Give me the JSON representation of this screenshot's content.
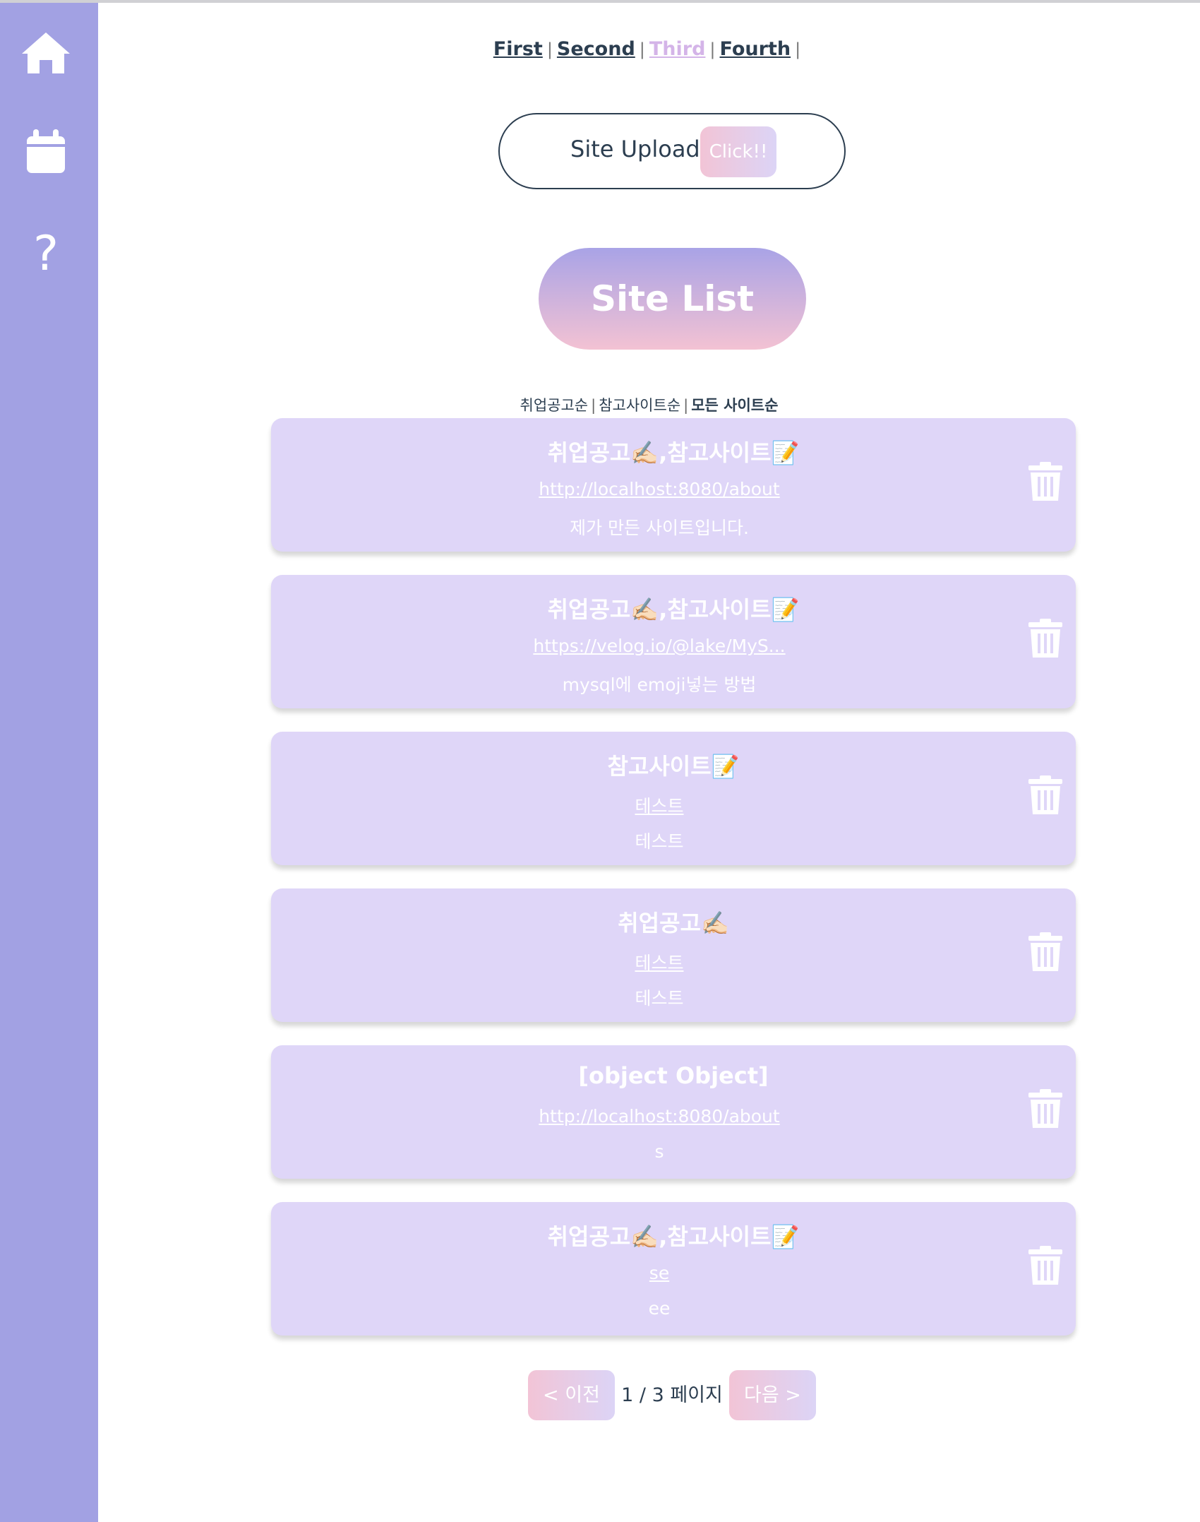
{
  "colors": {
    "sidebar": "#a2a1e3",
    "card": "#dfd6f8",
    "accent_gradient": [
      "#f2c4d6",
      "#dcd4f6"
    ],
    "text": "#2c3e50",
    "active_nav": "#d4b4e8"
  },
  "sidebar": {
    "items": [
      {
        "icon": "home-icon"
      },
      {
        "icon": "calendar-icon"
      },
      {
        "icon": "help-icon",
        "glyph": "?"
      }
    ]
  },
  "nav": {
    "links": [
      {
        "label": "First"
      },
      {
        "label": "Second"
      },
      {
        "label": "Third",
        "active": true
      },
      {
        "label": "Fourth"
      }
    ],
    "separator": "|"
  },
  "upload": {
    "label": "Site Upload",
    "button": "Click!!"
  },
  "site_list": {
    "title": "Site List",
    "sort_options": [
      "취업공고순",
      "참고사이트순",
      "모든 사이트순"
    ],
    "sort_separator": "|",
    "selected_sort": "모든 사이트순",
    "cards": [
      {
        "title": "취업공고✍🏻,참고사이트📝",
        "url": "http://localhost:8080/about",
        "description": "제가 만든 사이트입니다."
      },
      {
        "title": "취업공고✍🏻,참고사이트📝",
        "url": "https://velog.io/@lake/MyS...",
        "description": "mysql에 emoji넣는 방법"
      },
      {
        "title": "참고사이트📝",
        "url": "테스트",
        "description": "테스트"
      },
      {
        "title": "취업공고✍🏻",
        "url": "테스트",
        "description": "테스트"
      },
      {
        "title": "[object Object]",
        "url": "http://localhost:8080/about",
        "description": "s"
      },
      {
        "title": "취업공고✍🏻,참고사이트📝",
        "url": "se",
        "description": "ee"
      }
    ]
  },
  "pagination": {
    "prev": "< 이전",
    "info": "1 / 3 페이지",
    "next": "다음 >"
  }
}
